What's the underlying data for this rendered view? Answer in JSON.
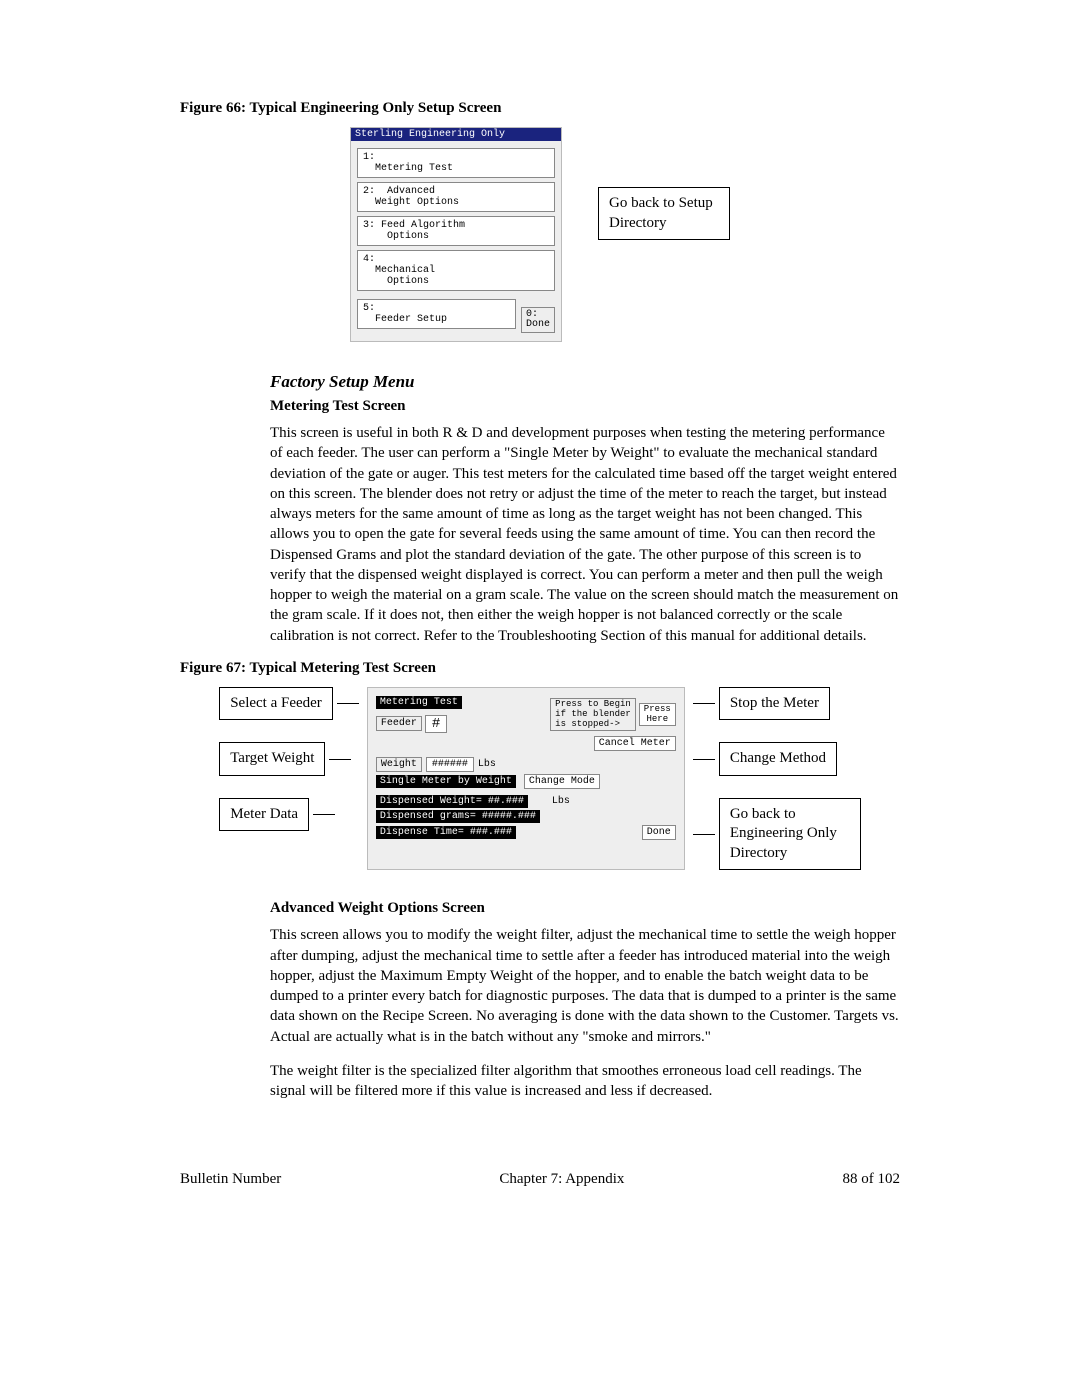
{
  "fig66": {
    "title": "Figure 66: Typical Engineering Only Setup Screen",
    "panel_title": "Sterling Engineering Only",
    "item1_no": "1:",
    "item1": "Metering Test",
    "item2_no": "2:",
    "item2a": "Advanced",
    "item2b": "Weight Options",
    "item3_no": "3:",
    "item3a": "Feed Algorithm",
    "item3b": "Options",
    "item4_no": "4:",
    "item4a": "Mechanical",
    "item4b": "Options",
    "item5_no": "5:",
    "item5": "Feeder Setup",
    "done_no": "0:",
    "done": "Done",
    "callout": "Go back to Setup Directory"
  },
  "factory_hdr": "Factory Setup Menu",
  "metering_hdr": "Metering Test Screen",
  "metering_para": "This screen is useful in both R & D and development purposes when testing the metering performance of each feeder.  The user can perform a \"Single Meter by Weight\" to evaluate the mechanical standard deviation of the gate or auger.  This test meters for the calculated time based off the target weight entered on this screen.  The blender does not retry or adjust the time of the meter to reach the target, but instead always meters for the same amount of time as long as the target weight has not been changed.  This allows you to open the gate for several feeds using the same amount of time.  You can then record the Dispensed Grams and plot the standard deviation of the gate.  The other purpose of this screen is to verify that the dispensed weight displayed is correct.  You can perform a meter and then pull the weigh hopper to weigh the material on a gram scale.  The value on the screen should match the measurement on the gram scale.  If it does not, then either the weigh hopper is not balanced correctly or the scale calibration is not correct.  Refer to the Troubleshooting Section of this manual for additional details.",
  "fig67": {
    "title": "Figure 67: Typical Metering Test Screen",
    "left_selfeeder": "Select a Feeder",
    "left_target": "Target Weight",
    "left_meter": "Meter Data",
    "right_stop": "Stop the Meter",
    "right_change": "Change Method",
    "right_goback": "Go back to Engineering Only Directory",
    "panel_title": "Metering Test",
    "begin_box": "Press to Begin\nif the blender\nis stopped->",
    "press_here": "Press\nHere",
    "feeder_lbl": "Feeder",
    "feeder_val": "#",
    "cancel": "Cancel Meter",
    "weight_lbl": "Weight",
    "weight_val": "######",
    "weight_unit": "Lbs",
    "single_meter": "Single Meter by Weight",
    "change_mode": "Change Mode",
    "disp_weight": "Dispensed Weight=  ##.###",
    "disp_grams": "Dispensed grams=  #####.###",
    "disp_time": "Dispense Time=  ###.###",
    "lbs": "Lbs",
    "done": "Done"
  },
  "adv_hdr": "Advanced Weight Options Screen",
  "adv_para1": "This screen allows you to modify the weight filter, adjust the mechanical time to settle the weigh hopper after dumping, adjust the mechanical time to settle after a feeder has introduced material into the weigh hopper, adjust the Maximum Empty Weight of the hopper, and to enable the batch weight data to be dumped to a printer every batch for diagnostic purposes.  The data that is dumped to a printer is the same data shown on the Recipe Screen.  No averaging is done with the data shown to the Customer.  Targets vs. Actual are actually what is in the batch without any \"smoke and mirrors.\"",
  "adv_para2": "The weight filter is the specialized filter algorithm that smoothes erroneous load cell readings.  The signal will be filtered more if this value is increased and less if decreased.",
  "footer": {
    "left": "Bulletin Number",
    "center": "Chapter 7: Appendix",
    "right": "88 of 102"
  }
}
